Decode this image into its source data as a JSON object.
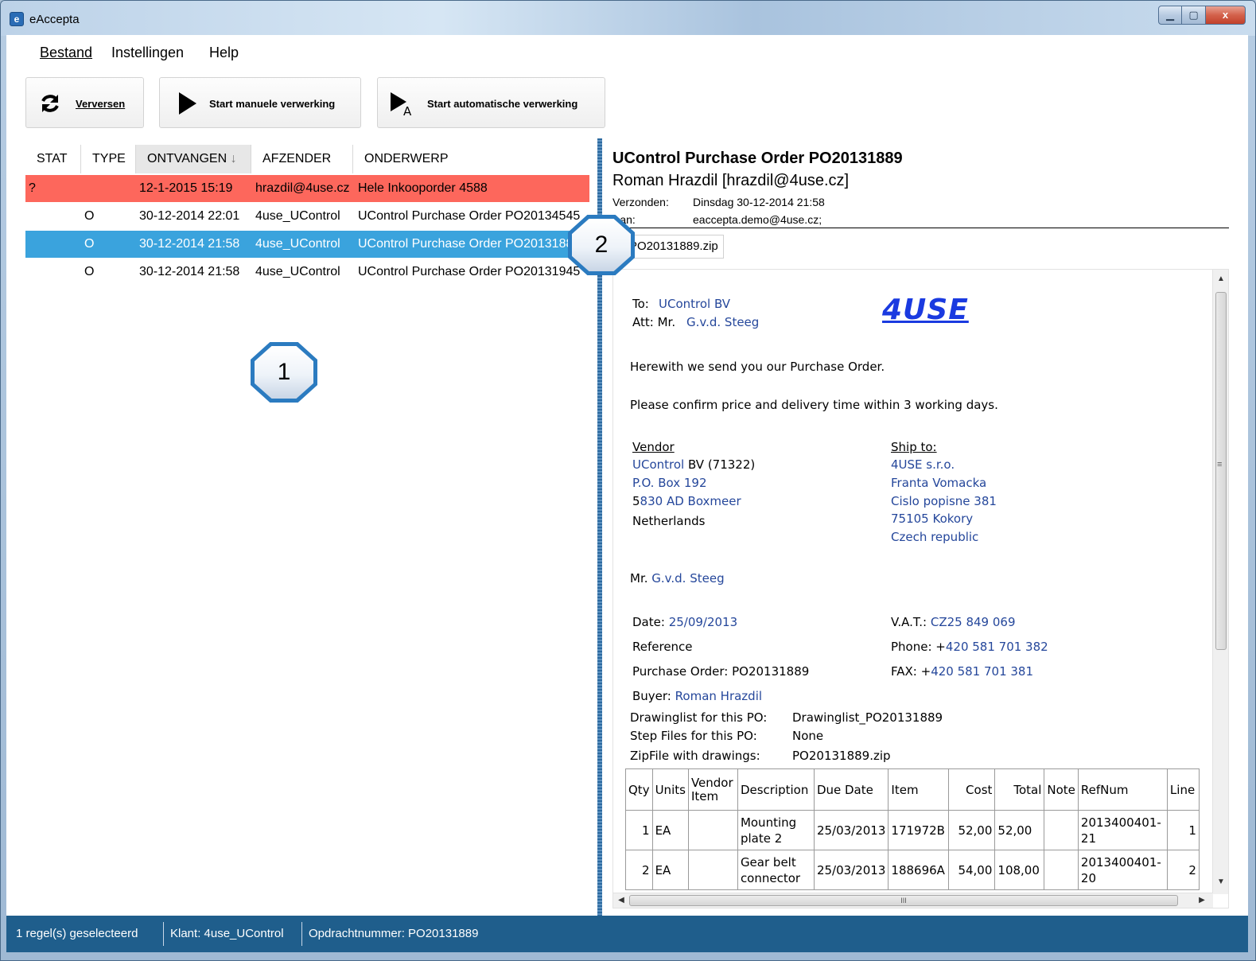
{
  "window": {
    "title": "eAccepta",
    "app_icon": "e",
    "controls": {
      "minimize": "▁",
      "maximize": "▢",
      "close": "x"
    }
  },
  "menu": [
    {
      "label": "Bestand"
    },
    {
      "label": "Instellingen"
    },
    {
      "label": "Help"
    }
  ],
  "toolbar": {
    "refresh": {
      "label": "Verversen",
      "icon": "refresh-icon"
    },
    "manual": {
      "label": "Start manuele verwerking",
      "icon": "play-icon"
    },
    "auto": {
      "label": "Start automatische verwerking",
      "icon": "auto-play-icon"
    }
  },
  "list": {
    "columns": {
      "stat": "STAT",
      "type": "TYPE",
      "received": "ONTVANGEN",
      "received_sort": "↓",
      "sender": "AFZENDER",
      "subject": "ONDERWERP"
    },
    "rows": [
      {
        "stat": "?",
        "type": "",
        "received": "12-1-2015 15:19",
        "sender": "hrazdil@4use.cz",
        "subject": "Hele Inkooporder 4588"
      },
      {
        "stat": "",
        "type": "O",
        "received": "30-12-2014 22:01",
        "sender": "4use_UControl",
        "subject": "UControl Purchase Order PO20134545"
      },
      {
        "stat": "",
        "type": "O",
        "received": "30-12-2014 21:58",
        "sender": "4use_UControl",
        "subject": "UControl Purchase Order PO20131889"
      },
      {
        "stat": "",
        "type": "O",
        "received": "30-12-2014 21:58",
        "sender": "4use_UControl",
        "subject": "UControl Purchase Order PO20131945"
      }
    ]
  },
  "preview": {
    "subject": "UControl Purchase Order PO20131889",
    "from": "Roman Hrazdil [hrazdil@4use.cz]",
    "sent_label": "Verzonden:",
    "sent_value": "Dinsdag 30-12-2014 21:58",
    "to_label": "Aan:",
    "to_value": "eaccepta.demo@4use.cz;",
    "attachment": "PO20131889.zip",
    "doc": {
      "to_label": "To:",
      "to_value": "UControl BV",
      "att_label": "Att: Mr.",
      "att_value": "G.v.d. Steeg",
      "logo": "4USE",
      "intro": "Herewith we send you our Purchase Order.",
      "confirm": "Please confirm price and delivery time within 3 working days.",
      "vendor": {
        "heading": "Vendor",
        "name_link": "UControl",
        "name_rest": " BV (71322)",
        "line1": "P.O. Box 192",
        "line2_prefix": "5",
        "line2_rest": "830 AD Boxmeer",
        "country": "Netherlands"
      },
      "ship": {
        "heading": "Ship to:",
        "line1": "4USE s.r.o.",
        "line2": "Franta Vomacka",
        "line3": "Cislo popisne 381",
        "line4": "75105 Kokory",
        "line5": "Czech republic"
      },
      "contact_prefix": "Mr.",
      "contact_name": "G.v.d. Steeg",
      "date_label": "Date:",
      "date_value": "25/09/2013",
      "reference_label": "Reference",
      "po_label": "Purchase Order:",
      "po_value": "PO20131889",
      "buyer_label": "Buyer:",
      "buyer_value": "Roman Hrazdil",
      "vat_label": "V.A.T.:",
      "vat_value": "CZ25 849 069",
      "phone_label": "Phone: +",
      "phone_value": "420 581 701 382",
      "fax_label": "FAX: +",
      "fax_value": "420 581 701 381",
      "drawinglist_label": "Drawinglist for this PO:",
      "drawinglist_value": "Drawinglist_PO20131889",
      "step_label": "Step Files for this PO:",
      "step_value": "None",
      "zip_label": "ZipFile with drawings:",
      "zip_value": "PO20131889.zip",
      "table": {
        "headers": [
          "Qty",
          "Units",
          "Vendor Item",
          "Description",
          "Due Date",
          "Item",
          "Cost",
          "Total",
          "Note",
          "RefNum",
          "Line"
        ],
        "rows": [
          {
            "qty": "1",
            "units": "EA",
            "vendor_item": "",
            "description": "Mounting plate 2",
            "due": "25/03/2013",
            "item": "171972B",
            "cost": "52,00",
            "total": "52,00",
            "note": "",
            "refnum": "2013400401-21",
            "line": "1"
          },
          {
            "qty": "2",
            "units": "EA",
            "vendor_item": "",
            "description": "Gear belt connector",
            "due": "25/03/2013",
            "item": "188696A",
            "cost": "54,00",
            "total": "108,00",
            "note": "",
            "refnum": "2013400401-20",
            "line": "2"
          }
        ]
      }
    },
    "hscroll_grip": "III",
    "vscroll_grip": "≡"
  },
  "callouts": {
    "one": "1",
    "two": "2"
  },
  "status": {
    "selected": "1 regel(s) geselecteerd",
    "client": "Klant: 4use_UControl",
    "order": "Opdrachtnummer: PO20131889"
  },
  "colors": {
    "error_row": "#fd675c",
    "selected_row": "#3aa3dd",
    "statusbar": "#1f5e8c",
    "link": "#25479b"
  }
}
